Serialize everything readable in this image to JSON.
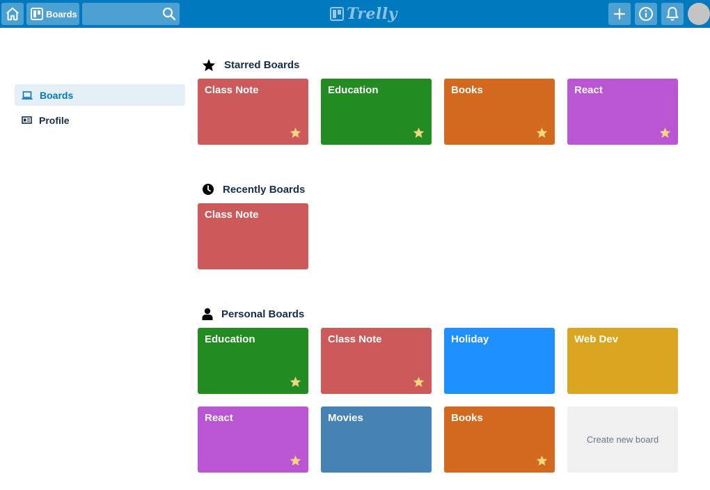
{
  "topbar": {
    "boards_label": "Boards",
    "search_value": "",
    "logo_text": "Trelly",
    "color": "#0079bf"
  },
  "sidebar": {
    "items": [
      {
        "label": "Boards",
        "icon": "laptop-icon",
        "active": true
      },
      {
        "label": "Profile",
        "icon": "id-card-icon",
        "active": false
      }
    ]
  },
  "sections": {
    "starred": {
      "title": "Starred Boards",
      "icon": "star-icon",
      "boards": [
        {
          "name": "Class Note",
          "color": "#cd5a5a",
          "starred": true
        },
        {
          "name": "Education",
          "color": "#228b22",
          "starred": true
        },
        {
          "name": "Books",
          "color": "#d2691e",
          "starred": true
        },
        {
          "name": "React",
          "color": "#ba55d3",
          "starred": true
        }
      ]
    },
    "recent": {
      "title": "Recently Boards",
      "icon": "clock-icon",
      "boards": [
        {
          "name": "Class Note",
          "color": "#cd5a5a",
          "starred": false
        }
      ]
    },
    "personal": {
      "title": "Personal Boards",
      "icon": "user-icon",
      "boards": [
        {
          "name": "Education",
          "color": "#228b22",
          "starred": true
        },
        {
          "name": "Class Note",
          "color": "#cd5a5a",
          "starred": true
        },
        {
          "name": "Holiday",
          "color": "#1e90ff",
          "starred": false
        },
        {
          "name": "Web Dev",
          "color": "#daa520",
          "starred": false
        },
        {
          "name": "React",
          "color": "#ba55d3",
          "starred": true
        },
        {
          "name": "Movies",
          "color": "#4682b4",
          "starred": false
        },
        {
          "name": "Books",
          "color": "#d2691e",
          "starred": true
        }
      ],
      "create_label": "Create new board"
    }
  },
  "colors": {
    "star": "#f2d680"
  }
}
